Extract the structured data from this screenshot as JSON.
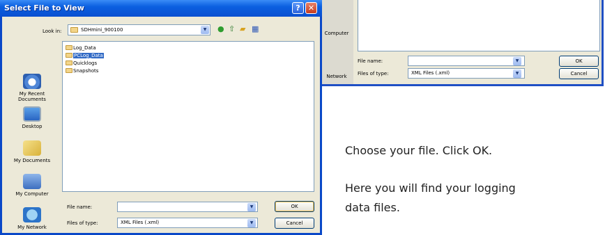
{
  "background_dialog": {
    "side_places": [
      "Computer",
      "Network"
    ],
    "file_name_label": "File name:",
    "file_name_value": "",
    "files_of_type_label": "Files of type:",
    "files_of_type_value": "XML Files (.xml)",
    "ok_label": "OK",
    "cancel_label": "Cancel"
  },
  "dialog": {
    "title": "Select File to View",
    "help_button": "?",
    "close_button": "✕",
    "look_in_label": "Look in:",
    "look_in_value": "SDHmini_900100",
    "toolbar_icons": [
      "back-icon",
      "up-folder-icon",
      "new-folder-icon",
      "views-menu-icon"
    ],
    "places": [
      {
        "label": "My Recent Documents",
        "icon": "recent-documents-icon"
      },
      {
        "label": "Desktop",
        "icon": "desktop-icon"
      },
      {
        "label": "My Documents",
        "icon": "my-documents-icon"
      },
      {
        "label": "My Computer",
        "icon": "my-computer-icon"
      },
      {
        "label": "My Network",
        "icon": "my-network-icon"
      }
    ],
    "files": [
      {
        "name": "Log_Data",
        "selected": false
      },
      {
        "name": "PCLog_Data",
        "selected": true
      },
      {
        "name": "Quicklogs",
        "selected": false
      },
      {
        "name": "Snapshots",
        "selected": false
      }
    ],
    "file_name_label": "File name:",
    "file_name_value": "",
    "files_of_type_label": "Files of type:",
    "files_of_type_value": "XML Files (.xml)",
    "ok_label": "OK",
    "cancel_label": "Cancel"
  },
  "instructions": {
    "line1": "Choose your file. Click OK.",
    "line2a": "Here you will find your logging",
    "line2b": "data files."
  },
  "colors": {
    "title_bar": "#0b5fe0",
    "dialog_face": "#ece9d8",
    "selection": "#316ac5"
  }
}
